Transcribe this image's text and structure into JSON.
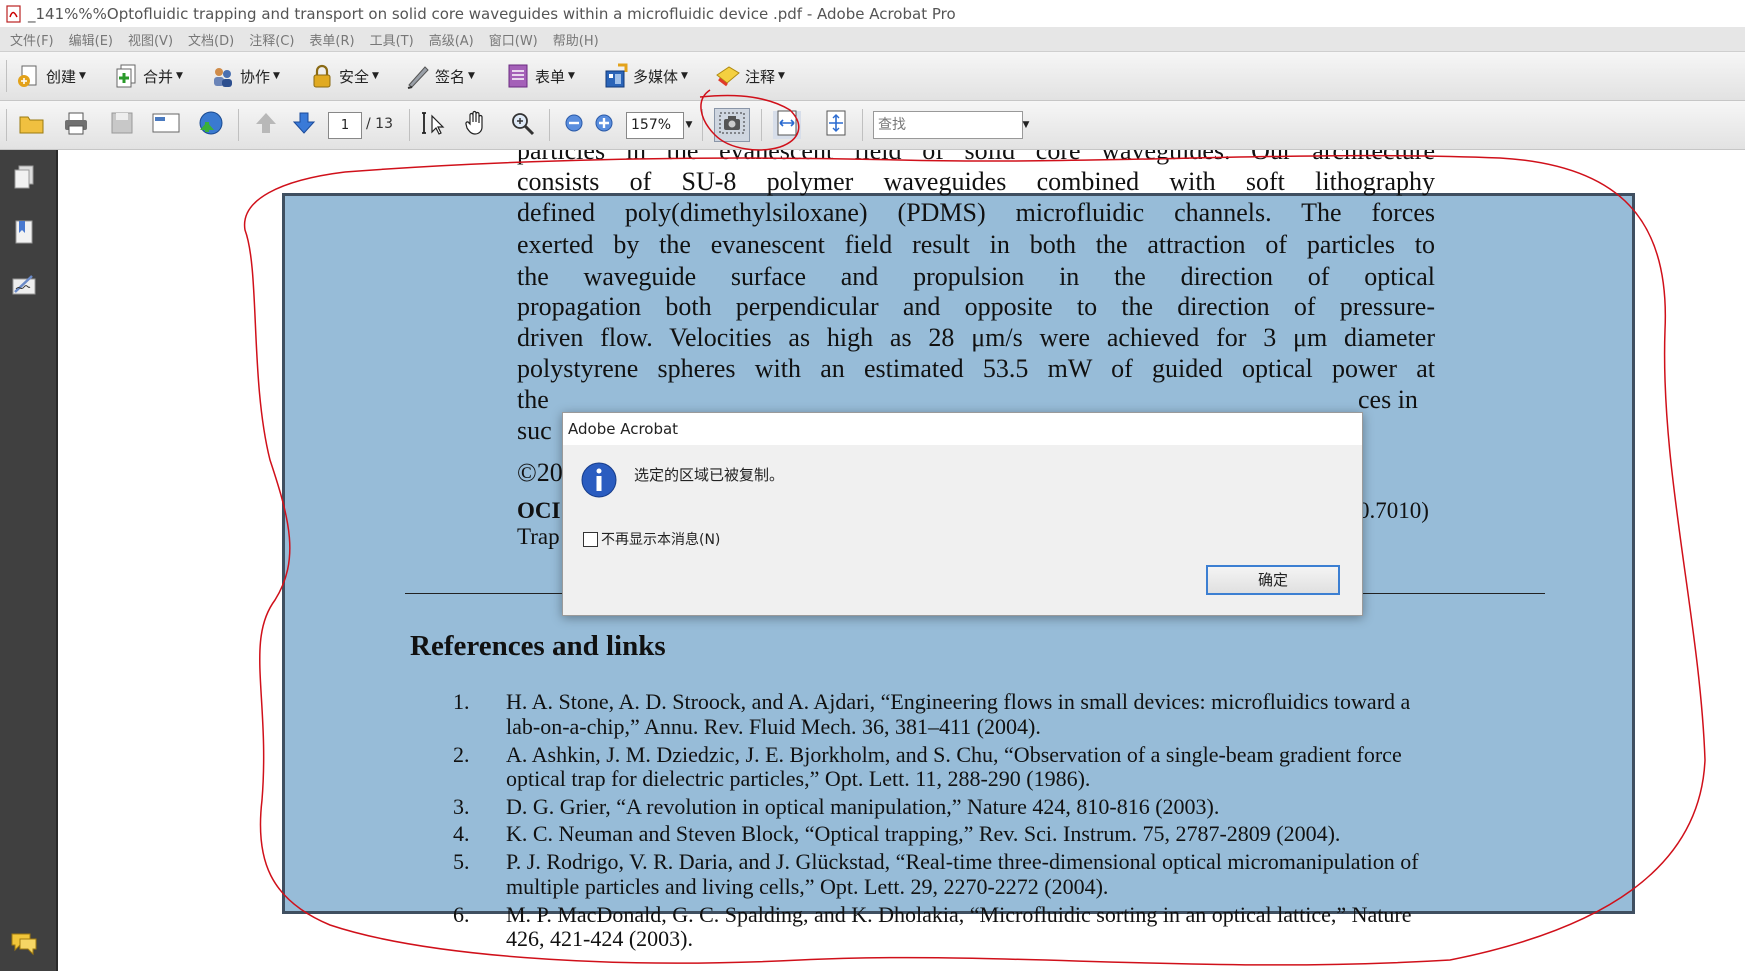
{
  "window": {
    "title": "_141%%%Optofluidic trapping and transport on solid core waveguides within a microfluidic device .pdf - Adobe Acrobat Pro"
  },
  "menu": [
    "文件(F)",
    "编辑(E)",
    "视图(V)",
    "文档(D)",
    "注释(C)",
    "表单(R)",
    "工具(T)",
    "高级(A)",
    "窗口(W)",
    "帮助(H)"
  ],
  "task_toolbar": {
    "create": "创建",
    "combine": "合并",
    "collaborate": "协作",
    "secure": "安全",
    "sign": "签名",
    "forms": "表单",
    "multimedia": "多媒体",
    "comment": "注释"
  },
  "nav_toolbar": {
    "page_current": "1",
    "page_total": "/ 13",
    "zoom": "157%",
    "find_placeholder": "查找"
  },
  "document": {
    "abstract_lines": [
      "particles in the evanescent field of solid core waveguides.  Our architecture",
      "consists  of  SU-8  polymer  waveguides  combined  with  soft  lithography",
      "defined poly(dimethylsiloxane) (PDMS) microfluidic channels.  The forces",
      "exerted by the evanescent field result in both the attraction of particles to",
      "the  waveguide  surface  and  propulsion  in  the  direction  of  optical",
      "propagation both perpendicular and opposite to the direction of pressure-",
      "driven flow. Velocities as high as 28 μm/s were achieved for 3 μm diameter",
      "polystyrene spheres with an estimated 53.5 mW of guided optical power at"
    ],
    "partial": {
      "left_the": "the",
      "right_ces": "ces in",
      "left_suc": "suc",
      "copyright": "©20",
      "ocis_left": "OCI",
      "ocis_right": "0.7010)",
      "trap_left": "Trap"
    },
    "refs_heading": "References and links",
    "references": [
      {
        "num": "1.",
        "lines": [
          "H. A. Stone, A. D. Stroock, and A. Ajdari, “Engineering flows in small devices: microfluidics toward a",
          "lab-on-a-chip,” Annu. Rev. Fluid Mech. 36, 381–411 (2004)."
        ]
      },
      {
        "num": "2.",
        "lines": [
          "A. Ashkin, J. M. Dziedzic, J. E. Bjorkholm, and S. Chu, “Observation of a single-beam gradient force",
          "optical trap for dielectric particles,” Opt. Lett. 11, 288-290 (1986)."
        ]
      },
      {
        "num": "3.",
        "lines": [
          "D. G. Grier, “A revolution in optical manipulation,” Nature 424, 810-816 (2003)."
        ]
      },
      {
        "num": "4.",
        "lines": [
          "K. C. Neuman and Steven Block, “Optical trapping,” Rev. Sci. Instrum. 75, 2787-2809 (2004)."
        ]
      },
      {
        "num": "5.",
        "lines": [
          "P. J. Rodrigo, V. R. Daria, and J. Glückstad, “Real-time three-dimensional optical micromanipulation of",
          "multiple particles and living cells,” Opt. Lett. 29, 2270-2272 (2004)."
        ]
      },
      {
        "num": "6.",
        "lines": [
          "M. P. MacDonald, G. C. Spalding, and K. Dholakia, “Microfluidic sorting in an optical lattice,” Nature",
          "426, 421-424 (2003)."
        ]
      }
    ]
  },
  "dialog": {
    "title": "Adobe Acrobat",
    "message": "选定的区域已被复制。",
    "checkbox_label": "不再显示本消息(N)",
    "ok": "确定"
  },
  "colors": {
    "selection_fill": "#97bcd8",
    "selection_border": "#3f4f60",
    "annotation_red": "#d0101a",
    "sidebar": "#404040",
    "dialog_button_border": "#3c7fd2"
  }
}
